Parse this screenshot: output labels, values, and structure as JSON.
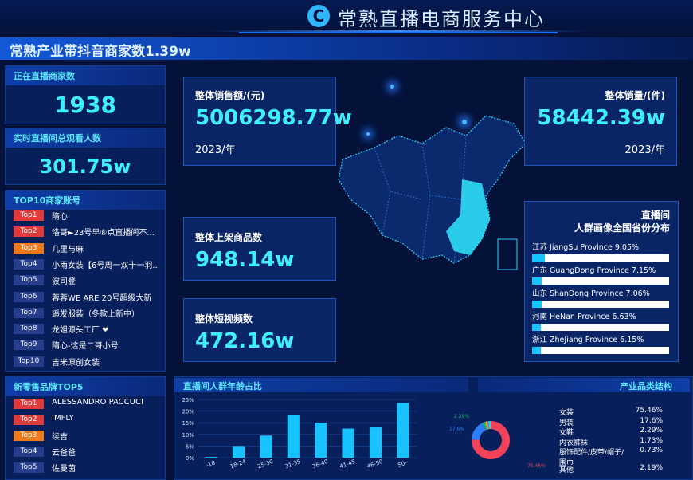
{
  "header": {
    "logo_glyph": "C",
    "title": "常熟直播电商服务中心"
  },
  "banner": {
    "text": "常熟产业带抖音商家数1.39w"
  },
  "live_merchants": {
    "label": "正在直播商家数",
    "value": "1938"
  },
  "viewers": {
    "label": "实时直播间总观看人数",
    "value": "301.75w"
  },
  "top10": {
    "label": "TOP10商家账号",
    "items": [
      {
        "rank": "Top1",
        "name": "隋心",
        "color": "red"
      },
      {
        "rank": "Top2",
        "name": "洛哥►23号早⑧点直播间不...",
        "color": "red"
      },
      {
        "rank": "Top3",
        "name": "几里与麻",
        "color": "org"
      },
      {
        "rank": "Top4",
        "name": "小雨女装【6号周一双十一羽...",
        "color": "blu"
      },
      {
        "rank": "Top5",
        "name": "波司登",
        "color": "blu"
      },
      {
        "rank": "Top6",
        "name": "蓉蓉WE ARE 20号超级大新",
        "color": "blu"
      },
      {
        "rank": "Top7",
        "name": "遥发服装（冬款上新中）",
        "color": "blu"
      },
      {
        "rank": "Top8",
        "name": "龙姐源头工厂 ❤",
        "color": "blu"
      },
      {
        "rank": "Top9",
        "name": "隋心-这是二哥小号",
        "color": "blu"
      },
      {
        "rank": "Top10",
        "name": "吉米原创女装",
        "color": "blu"
      }
    ]
  },
  "brands": {
    "label": "新零售品牌TOP5",
    "items": [
      {
        "rank": "Top1",
        "name": "ALESSANDRO PACCUCI",
        "color": "red"
      },
      {
        "rank": "Top2",
        "name": "IMFLY",
        "color": "red"
      },
      {
        "rank": "Top3",
        "name": "续吉",
        "color": "org"
      },
      {
        "rank": "Top4",
        "name": "云爸爸",
        "color": "blu"
      },
      {
        "rank": "Top5",
        "name": "佐曼茵",
        "color": "blu"
      }
    ]
  },
  "sales_amount": {
    "label": "整体销售额/(元)",
    "value": "5006298.77w",
    "year": "2023/年"
  },
  "sales_volume": {
    "label": "整体销量/(件)",
    "value": "58442.39w",
    "year": "2023/年"
  },
  "products": {
    "label": "整体上架商品数",
    "value": "948.14w"
  },
  "videos": {
    "label": "整体短视频数",
    "value": "472.16w"
  },
  "province": {
    "title1": "直播间",
    "title2": "人群画像全国省份分布",
    "items": [
      {
        "label": "江苏 JiangSu Province  9.05%",
        "pct": 9.05
      },
      {
        "label": "广东 GuangDong Province  7.15%",
        "pct": 7.15
      },
      {
        "label": "山东 ShanDong Province  7.06%",
        "pct": 7.06
      },
      {
        "label": "河南 HeNan Province  6.63%",
        "pct": 6.63
      },
      {
        "label": "浙江 ZheJiang Province  6.15%",
        "pct": 6.15
      }
    ]
  },
  "age_chart_title": "直播间人群年龄占比",
  "category_title": "产业品类结构",
  "chart_data": [
    {
      "type": "bar",
      "title": "直播间人群年龄占比",
      "categories": [
        "-18",
        "18-24",
        "25-30",
        "31-35",
        "36-40",
        "41-45",
        "46-50",
        "50-"
      ],
      "values": [
        0.3,
        5.0,
        9.5,
        18.5,
        15.0,
        12.5,
        13.0,
        23.5
      ],
      "ylim": [
        0,
        25
      ],
      "yticks": [
        "0%",
        "5%",
        "10%",
        "15%",
        "20%",
        "25%"
      ],
      "grid": true,
      "color": "#19c3ff"
    },
    {
      "type": "pie",
      "title": "产业品类结构",
      "labels": [
        "女装",
        "男装",
        "女鞋",
        "内衣裤袜",
        "服饰配件/皮带/帽子/围巾",
        "其他"
      ],
      "values": [
        75.46,
        17.6,
        2.29,
        1.73,
        0.73,
        2.19
      ],
      "value_labels": [
        "75.46%",
        "17.6%",
        "2.29%",
        "1.73%",
        "0.73%",
        "2.19%"
      ],
      "colors": [
        "#f0435a",
        "#2f7cff",
        "#1fb56a",
        "#ffb020",
        "#8a5cff",
        "#35d0c8"
      ]
    }
  ]
}
